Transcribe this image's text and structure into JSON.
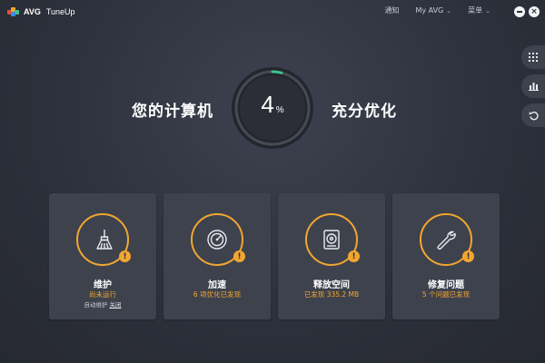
{
  "app": {
    "brand": "AVG",
    "product": "TuneUp"
  },
  "nav": {
    "notify": "通知",
    "account": "My AVG",
    "menu": "菜单"
  },
  "hero": {
    "left_text": "您的计算机",
    "right_text": "充分优化",
    "progress_value": "4",
    "progress_unit": "%",
    "progress_fraction": 0.04
  },
  "colors": {
    "accent": "#f2a630",
    "progress": "#3ec28f",
    "card_bg": "#3e424d"
  },
  "side_icons": [
    "grid-icon",
    "chart-icon",
    "undo-icon"
  ],
  "cards": [
    {
      "title": "维护",
      "status": "尚未运行",
      "extra_prefix": "自动维护",
      "extra_link": "关闭",
      "icon": "broom-icon"
    },
    {
      "title": "加速",
      "status": "6 项优化已发现",
      "icon": "speedometer-icon"
    },
    {
      "title": "释放空间",
      "status": "已发现 335.2 MB",
      "icon": "hard-drive-icon"
    },
    {
      "title": "修复问题",
      "status": "5 个问题已发现",
      "icon": "wrench-icon"
    }
  ]
}
